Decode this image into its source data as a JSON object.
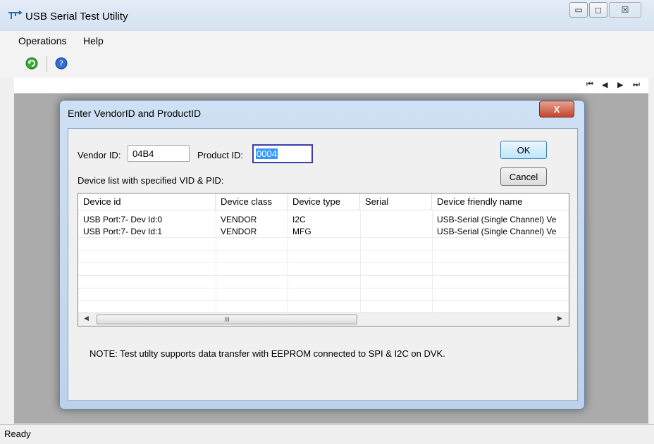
{
  "window": {
    "title": "USB Serial Test Utility",
    "caption_buttons": [
      "▭",
      "◻",
      "☒"
    ]
  },
  "menu": [
    "Operations",
    "Help"
  ],
  "toolbar": {
    "icons": [
      "refresh-icon",
      "help-icon"
    ]
  },
  "nav_buttons": [
    "⏮",
    "◀",
    "▶",
    "⏭"
  ],
  "status": {
    "text": "Ready"
  },
  "dialog": {
    "title": "Enter VendorID and ProductID",
    "close_label": "X",
    "vendor_label": "Vendor ID:",
    "vendor_value": "04B4",
    "product_label": "Product ID:",
    "product_value": "0004",
    "ok_label": "OK",
    "cancel_label": "Cancel",
    "device_list_label": "Device list with specified VID & PID:",
    "columns": [
      "Device id",
      "Device class",
      "Device type",
      "Serial",
      "Device friendly name"
    ],
    "rows": [
      [
        "USB Port:7- Dev Id:0",
        "VENDOR",
        "I2C",
        "",
        "USB-Serial (Single Channel) Ve"
      ],
      [
        "USB Port:7- Dev Id:1",
        "VENDOR",
        "MFG",
        "",
        "USB-Serial (Single Channel) Ve"
      ]
    ],
    "scroll_thumb_label": "III",
    "scroll_left": "◀",
    "scroll_right": "▶",
    "note": "NOTE: Test utilty supports data transfer with EEPROM connected to SPI & I2C on DVK."
  }
}
